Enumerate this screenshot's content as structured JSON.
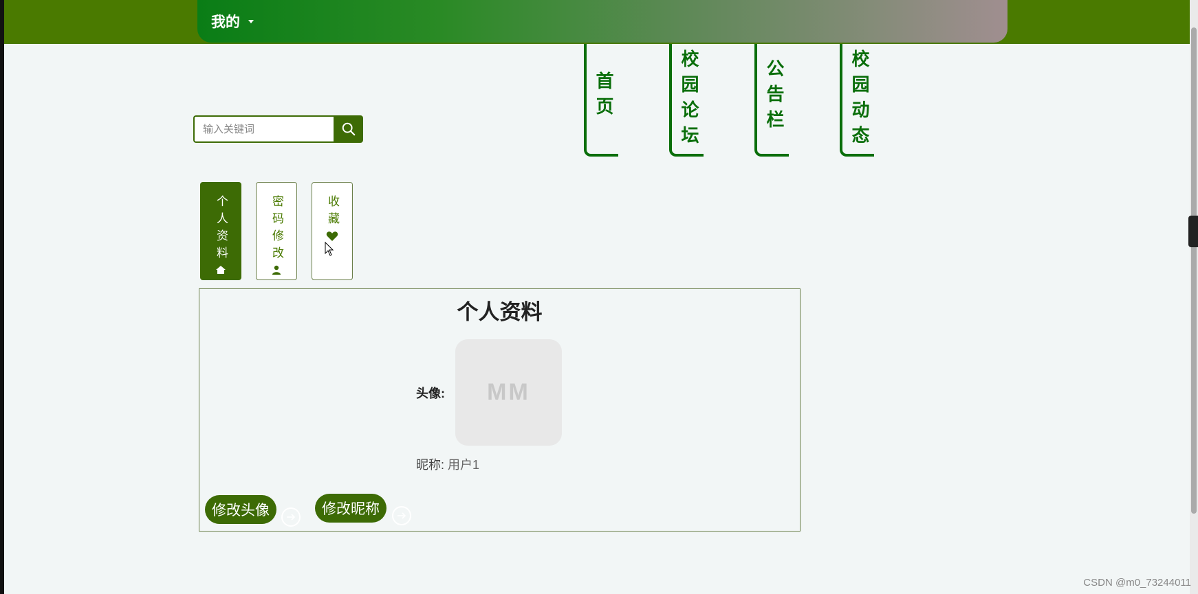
{
  "header": {
    "my_menu_label": "我的"
  },
  "search": {
    "placeholder": "输入关键词"
  },
  "nav": [
    {
      "label": "首页"
    },
    {
      "label": "校园论坛"
    },
    {
      "label": "公告栏"
    },
    {
      "label": "校园动态"
    }
  ],
  "tabs": [
    {
      "label": "个人资料",
      "icon": "home-icon",
      "active": true
    },
    {
      "label": "密码修改",
      "icon": "user-icon",
      "active": false
    },
    {
      "label": "收藏",
      "icon": "heart-icon",
      "active": false
    }
  ],
  "profile": {
    "title": "个人资料",
    "avatar_label": "头像:",
    "avatar_placeholder": "MM",
    "nickname_label": "昵称:",
    "nickname_value": "用户1",
    "change_avatar_button": "修改头像",
    "change_nickname_button": "修改昵称"
  },
  "watermark": "CSDN @m0_73244011",
  "colors": {
    "primary": "#3d6b05",
    "topbar": "#4a7a00",
    "nav": "#0a6e0a",
    "background": "#f2f6f6"
  }
}
